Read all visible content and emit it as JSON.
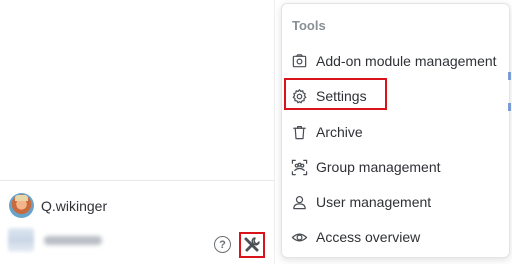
{
  "user": {
    "name": "Q.wikinger"
  },
  "footer": {
    "help_symbol": "?"
  },
  "menu": {
    "title": "Tools",
    "items": [
      {
        "label": "Add-on module management",
        "icon": "camera-box-icon"
      },
      {
        "label": "Settings",
        "icon": "gear-icon"
      },
      {
        "label": "Archive",
        "icon": "trash-icon"
      },
      {
        "label": "Group management",
        "icon": "group-icon"
      },
      {
        "label": "User management",
        "icon": "user-icon"
      },
      {
        "label": "Access overview",
        "icon": "eye-icon"
      }
    ]
  },
  "colors": {
    "highlight": "#d8131c",
    "title": "#8a8f96",
    "text": "#2f3136",
    "icon": "#4a4f55"
  }
}
